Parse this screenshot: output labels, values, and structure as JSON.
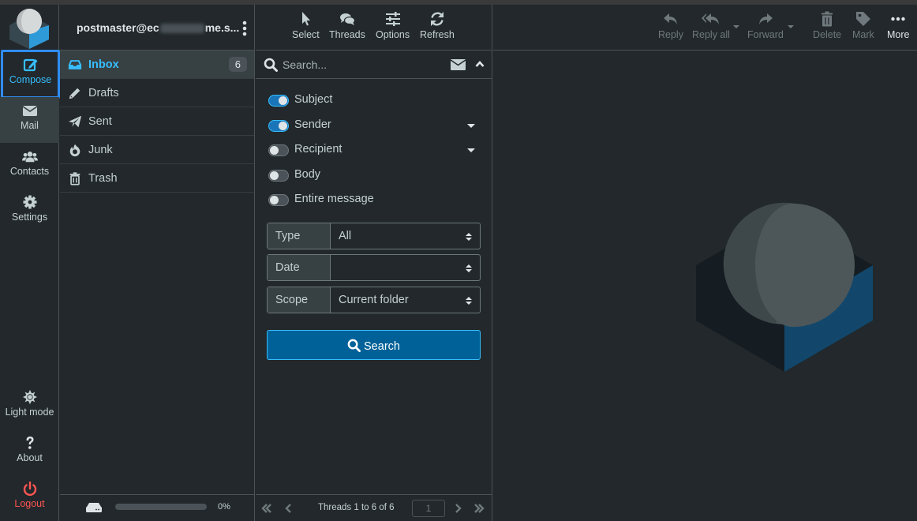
{
  "nav": {
    "compose": "Compose",
    "mail": "Mail",
    "contacts": "Contacts",
    "settings": "Settings",
    "light_mode": "Light mode",
    "about": "About",
    "logout": "Logout"
  },
  "account": {
    "prefix": "postmaster@ec",
    "suffix": "me.s..."
  },
  "folders": [
    {
      "label": "Inbox",
      "count": "6",
      "icon": "inbox-icon"
    },
    {
      "label": "Drafts",
      "icon": "pencil-icon"
    },
    {
      "label": "Sent",
      "icon": "paper-plane-icon"
    },
    {
      "label": "Junk",
      "icon": "fire-icon"
    },
    {
      "label": "Trash",
      "icon": "trash-icon"
    }
  ],
  "quota": {
    "percent_label": "0%",
    "used_fraction": 0
  },
  "list_toolbar": {
    "select": "Select",
    "threads": "Threads",
    "options": "Options",
    "refresh": "Refresh"
  },
  "search": {
    "placeholder": "Search...",
    "options": [
      {
        "label": "Subject",
        "on": true
      },
      {
        "label": "Sender",
        "on": true,
        "has_menu": true
      },
      {
        "label": "Recipient",
        "on": false,
        "has_menu": true
      },
      {
        "label": "Body",
        "on": false
      },
      {
        "label": "Entire message",
        "on": false
      }
    ],
    "type": {
      "label": "Type",
      "value": "All"
    },
    "date": {
      "label": "Date",
      "value": ""
    },
    "scope": {
      "label": "Scope",
      "value": "Current folder"
    },
    "button": "Search"
  },
  "pager": {
    "info": "Threads 1 to 6 of 6",
    "page": "1"
  },
  "message_toolbar": {
    "reply": "Reply",
    "reply_all": "Reply all",
    "forward": "Forward",
    "delete": "Delete",
    "mark": "Mark",
    "more": "More"
  },
  "colors": {
    "accent": "#37beff",
    "focus_ring": "#2f8cf2",
    "primary_button": "#006198",
    "logout": "#ff5552",
    "background": "#22282b"
  }
}
